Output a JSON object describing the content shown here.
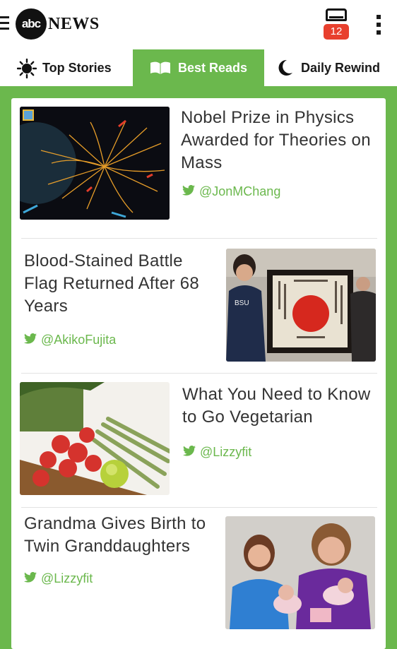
{
  "header": {
    "logo_mark": "abc",
    "logo_word": "NEWS",
    "inbox_count": "12",
    "icons": [
      "menu-icon",
      "inbox-icon",
      "overflow-menu-icon"
    ]
  },
  "tabs": [
    {
      "label": "Top Stories",
      "icon": "sun-icon",
      "active": false
    },
    {
      "label": "Best Reads",
      "icon": "open-book-icon",
      "active": true
    },
    {
      "label": "Daily Rewind",
      "icon": "moon-icon",
      "active": false
    }
  ],
  "colors": {
    "accent_green": "#6bb84d",
    "badge_red": "#e8402e",
    "headline_text": "#333333"
  },
  "stories": [
    {
      "headline": "Nobel Prize in Physics Awarded for Theories on Mass",
      "handle": "@JonMChang",
      "image": "particle-collision-image",
      "image_side": "left"
    },
    {
      "headline": "Blood-Stained Battle Flag Returned After 68 Years",
      "handle": "@AkikoFujita",
      "image": "battle-flag-photo",
      "image_side": "right"
    },
    {
      "headline": "What You Need to Know to Go Vegetarian",
      "handle": "@Lizzyfit",
      "image": "vegetables-photo",
      "image_side": "left"
    },
    {
      "headline": "Grandma Gives Birth to Twin Granddaughters",
      "handle": "@Lizzyfit",
      "image": "grandma-twins-photo",
      "image_side": "right"
    }
  ]
}
